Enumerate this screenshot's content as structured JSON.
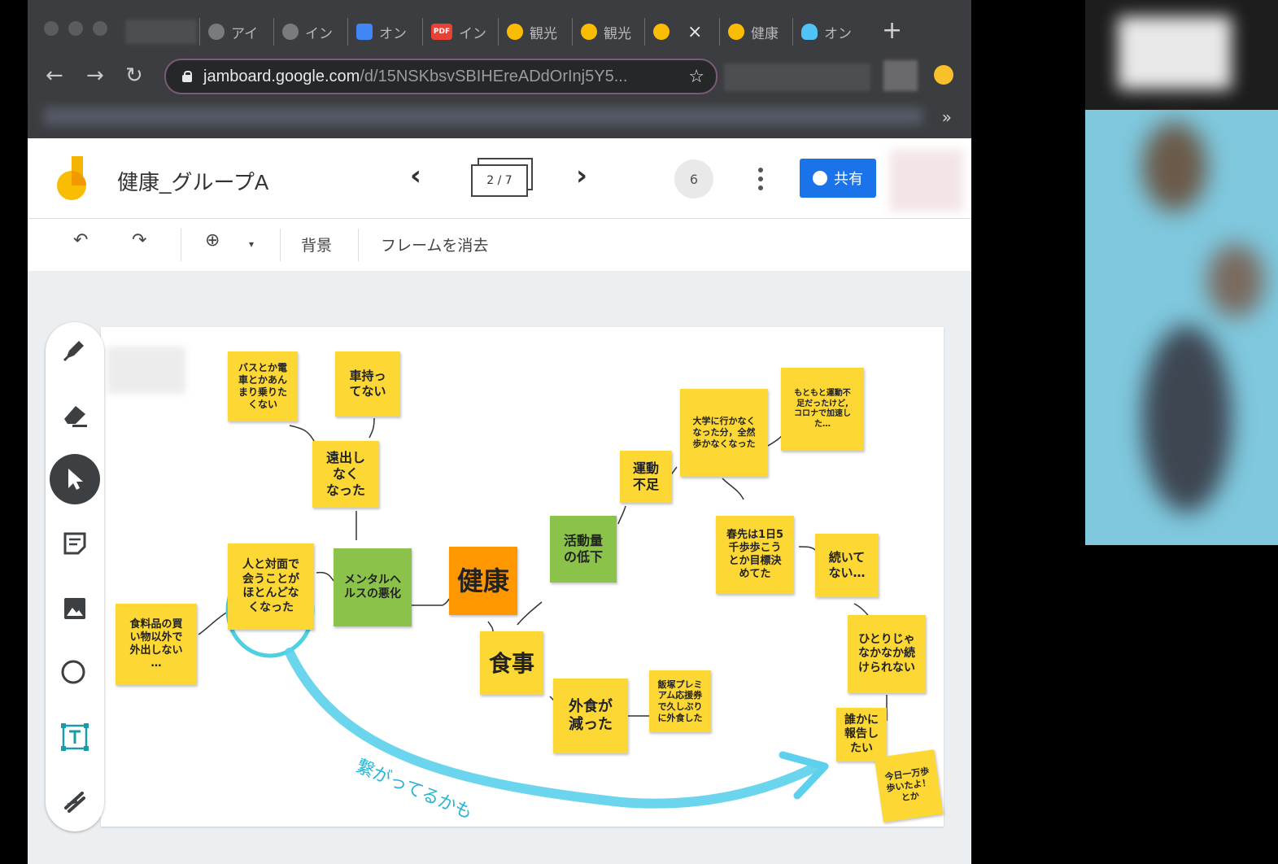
{
  "browser": {
    "tabs": [
      {
        "label": "アイ",
        "icon": "globe-icon",
        "color": "#7a7b7f"
      },
      {
        "label": "イン",
        "icon": "globe-icon",
        "color": "#7a7b7f"
      },
      {
        "label": "オン",
        "icon": "docs-icon",
        "color": "#4285f4"
      },
      {
        "label": "イン",
        "icon": "pdf-icon",
        "color": "#e94235",
        "badge": "PDF"
      },
      {
        "label": "観光",
        "icon": "jamboard-icon",
        "color": "#fbbc04"
      },
      {
        "label": "観光",
        "icon": "jamboard-icon",
        "color": "#fbbc04"
      },
      {
        "label": "",
        "icon": "jamboard-icon",
        "color": "#fbbc04",
        "active": true
      },
      {
        "label": "健康",
        "icon": "jamboard-icon",
        "color": "#fbbc04"
      },
      {
        "label": "オン",
        "icon": "bulb-icon",
        "color": "#4fc3f7"
      }
    ],
    "new_tab": "+",
    "url_host": "jamboard.google.com",
    "url_path": "/d/15NSKbsvSBIHEreADdOrInj5Y5...",
    "bookmarks_more": "»"
  },
  "app": {
    "title": "健康_グループA",
    "frame_indicator": "2 / 7",
    "viewer_count": "6",
    "share_label": "共有",
    "brand_color": "#fbbc04",
    "accent_color": "#1a73e8"
  },
  "toolbar": {
    "background_label": "背景",
    "clear_frame_label": "フレームを消去"
  },
  "tools": [
    "pen-icon",
    "eraser-icon",
    "select-icon",
    "sticky-note-icon",
    "image-icon",
    "circle-icon",
    "text-box-icon",
    "laser-icon"
  ],
  "notes": [
    {
      "id": "bus",
      "text": "バスとか電\n車とかあん\nまり乗りた\nくない",
      "color": "yellow"
    },
    {
      "id": "car",
      "text": "車持っ\nてない",
      "color": "yellow"
    },
    {
      "id": "outing",
      "text": "遠出し\nなく\nなった",
      "color": "yellow"
    },
    {
      "id": "people",
      "text": "人と対面で\n会うことが\nほとんどな\nくなった",
      "color": "yellow"
    },
    {
      "id": "mental",
      "text": "メンタルヘ\nルスの悪化",
      "color": "green"
    },
    {
      "id": "grocery",
      "text": "食料品の買\nい物以外で\n外出しない\n…",
      "color": "yellow"
    },
    {
      "id": "health",
      "text": "健康",
      "color": "orange"
    },
    {
      "id": "food",
      "text": "食事",
      "color": "yellow"
    },
    {
      "id": "activity",
      "text": "活動量\nの低下",
      "color": "green"
    },
    {
      "id": "exercise",
      "text": "運動\n不足",
      "color": "yellow"
    },
    {
      "id": "univ",
      "text": "大学に行かなく\nなった分，全然\n歩かなくなった",
      "color": "yellow"
    },
    {
      "id": "originally",
      "text": "もともと運動不\n足だったけど,\nコロナで加速し\nた…",
      "color": "yellow"
    },
    {
      "id": "spring",
      "text": "春先は1日5\n千歩歩こう\nとか目標決\nめてた",
      "color": "yellow"
    },
    {
      "id": "continue",
      "text": "続いて\nない…",
      "color": "yellow"
    },
    {
      "id": "alone",
      "text": "ひとりじゃ\nなかなか続\nけられない",
      "color": "yellow"
    },
    {
      "id": "report",
      "text": "誰かに\n報告し\nたい",
      "color": "yellow"
    },
    {
      "id": "today",
      "text": "今日一万歩\n歩いたよ！\nとか",
      "color": "yellow"
    },
    {
      "id": "eatout",
      "text": "外食が\n減った",
      "color": "yellow"
    },
    {
      "id": "iizuka",
      "text": "飯塚プレミ\nアム応援券\nで久しぶり\nに外食した",
      "color": "yellow"
    }
  ],
  "annotation": {
    "text": "繋がってるかも",
    "color": "#4dd0e1"
  }
}
